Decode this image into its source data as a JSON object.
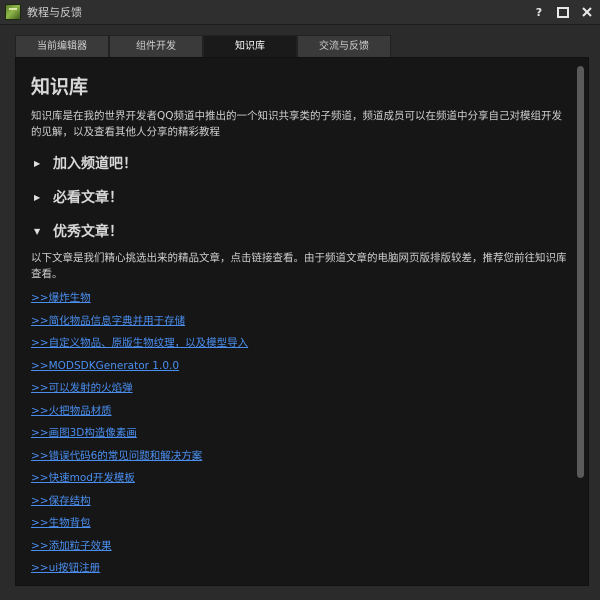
{
  "window": {
    "title": "教程与反馈",
    "help_label": "?"
  },
  "tabs": [
    {
      "label": "当前编辑器",
      "active": false
    },
    {
      "label": "组件开发",
      "active": false
    },
    {
      "label": "知识库",
      "active": true
    },
    {
      "label": "交流与反馈",
      "active": false
    }
  ],
  "main": {
    "title": "知识库",
    "intro": "知识库是在我的世界开发者QQ频道中推出的一个知识共享类的子频道，频道成员可以在频道中分享自己对模组开发的见解，以及查看其他人分享的精彩教程",
    "sections": [
      {
        "title": "加入频道吧！",
        "expanded": false
      },
      {
        "title": "必看文章！",
        "expanded": false
      },
      {
        "title": "优秀文章！",
        "expanded": true
      }
    ],
    "excellent_desc": "以下文章是我们精心挑选出来的精品文章，点击链接查看。由于频道文章的电脑网页版排版较差，推荐您前往知识库查看。",
    "links": [
      ">>爆炸生物",
      ">>简化物品信息字典并用于存储",
      ">>自定义物品、原版生物纹理，以及模型导入",
      ">>MODSDKGenerator 1.0.0",
      ">>可以发射的火焰弹",
      ">>火把物品材质",
      ">>画图3D构造像素画",
      ">>错误代码6的常见问题和解决方案",
      ">>快速mod开发模板",
      ">>保存结构",
      ">>生物背包",
      ">>添加粒子效果",
      ">>ui按钮注册"
    ]
  },
  "colors": {
    "link": "#4a8ef0",
    "panel_bg": "#161616",
    "window_bg": "#2b2b2b"
  }
}
